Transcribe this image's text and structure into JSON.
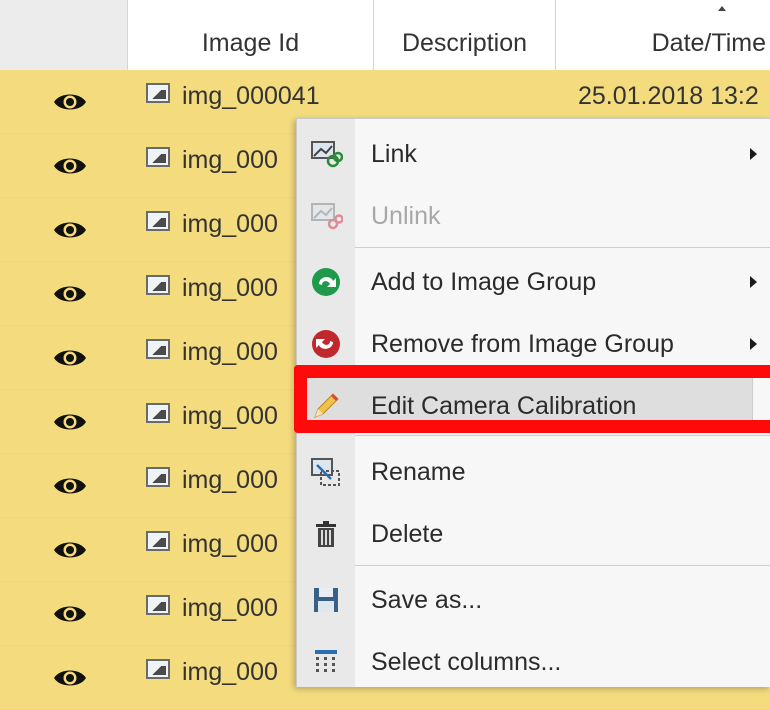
{
  "table": {
    "columns": [
      "",
      "Image Id",
      "Description",
      "Date/Time"
    ],
    "rows": [
      {
        "id": "img_000041",
        "date": "25.01.2018 13:2"
      },
      {
        "id": "img_000"
      },
      {
        "id": "img_000"
      },
      {
        "id": "img_000"
      },
      {
        "id": "img_000"
      },
      {
        "id": "img_000"
      },
      {
        "id": "img_000"
      },
      {
        "id": "img_000"
      },
      {
        "id": "img_000"
      },
      {
        "id": "img_000"
      }
    ],
    "row_color": "#f4dc7e"
  },
  "context_menu": {
    "items": [
      {
        "label": "Link",
        "icon": "link-icon",
        "submenu": true,
        "enabled": true
      },
      {
        "label": "Unlink",
        "icon": "unlink-icon",
        "submenu": false,
        "enabled": false
      },
      {
        "label": "Add to Image Group",
        "icon": "add-group-icon",
        "submenu": true,
        "enabled": true
      },
      {
        "label": "Remove from Image Group",
        "icon": "remove-group-icon",
        "submenu": true,
        "enabled": true
      },
      {
        "label": "Edit Camera Calibration",
        "icon": "pencil-icon",
        "submenu": false,
        "enabled": true,
        "highlighted": true
      },
      {
        "label": "Rename",
        "icon": "rename-icon",
        "submenu": false,
        "enabled": true
      },
      {
        "label": "Delete",
        "icon": "trash-icon",
        "submenu": false,
        "enabled": true
      },
      {
        "label": "Save as...",
        "icon": "save-icon",
        "submenu": false,
        "enabled": true
      },
      {
        "label": "Select columns...",
        "icon": "columns-icon",
        "submenu": false,
        "enabled": true
      }
    ]
  },
  "annotation": {
    "color": "#ff0a0a"
  }
}
